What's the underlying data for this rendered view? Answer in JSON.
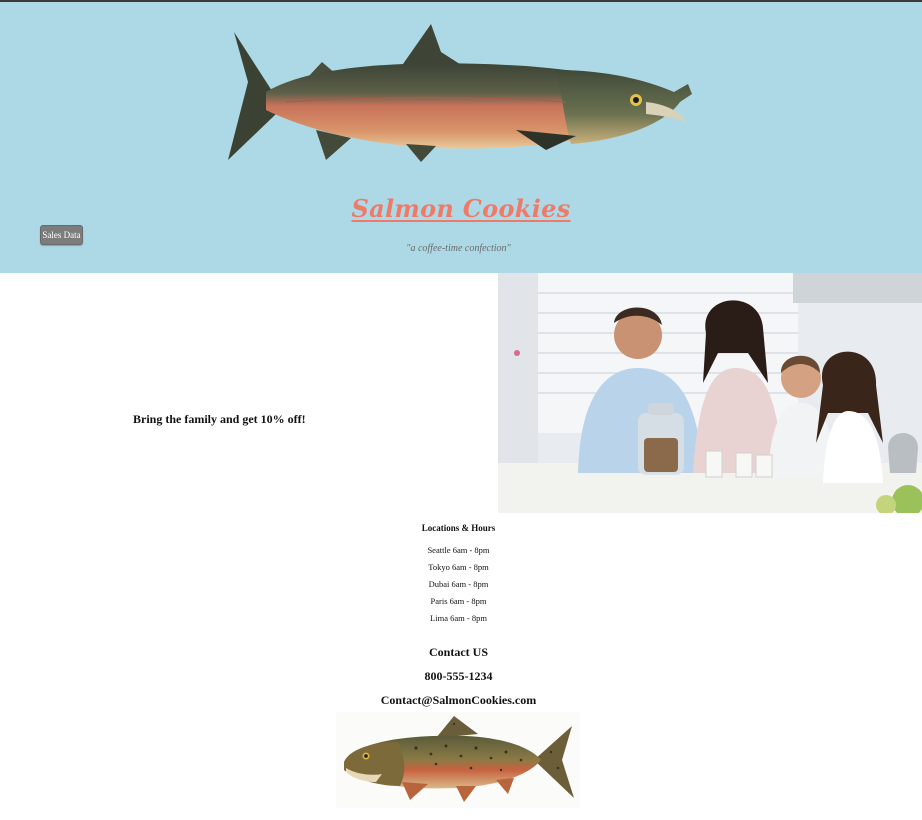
{
  "header": {
    "brand": "Salmon Cookies",
    "tagline": "\"a coffee-time confection\"",
    "sales_button": "Sales Data"
  },
  "promo": {
    "text": "Bring the family and get 10% off!"
  },
  "locations": {
    "title": "Locations & Hours",
    "items": [
      "Seattle 6am - 8pm",
      "Tokyo 6am - 8pm",
      "Dubai 6am - 8pm",
      "Paris 6am - 8pm",
      "Lima 6am - 8pm"
    ]
  },
  "contact": {
    "heading": "Contact US",
    "phone": "800-555-1234",
    "email": "Contact@SalmonCookies.com"
  },
  "colors": {
    "header_bg": "#acd9e5",
    "brand": "#f07a68",
    "button_bg": "#7c7c7c"
  }
}
